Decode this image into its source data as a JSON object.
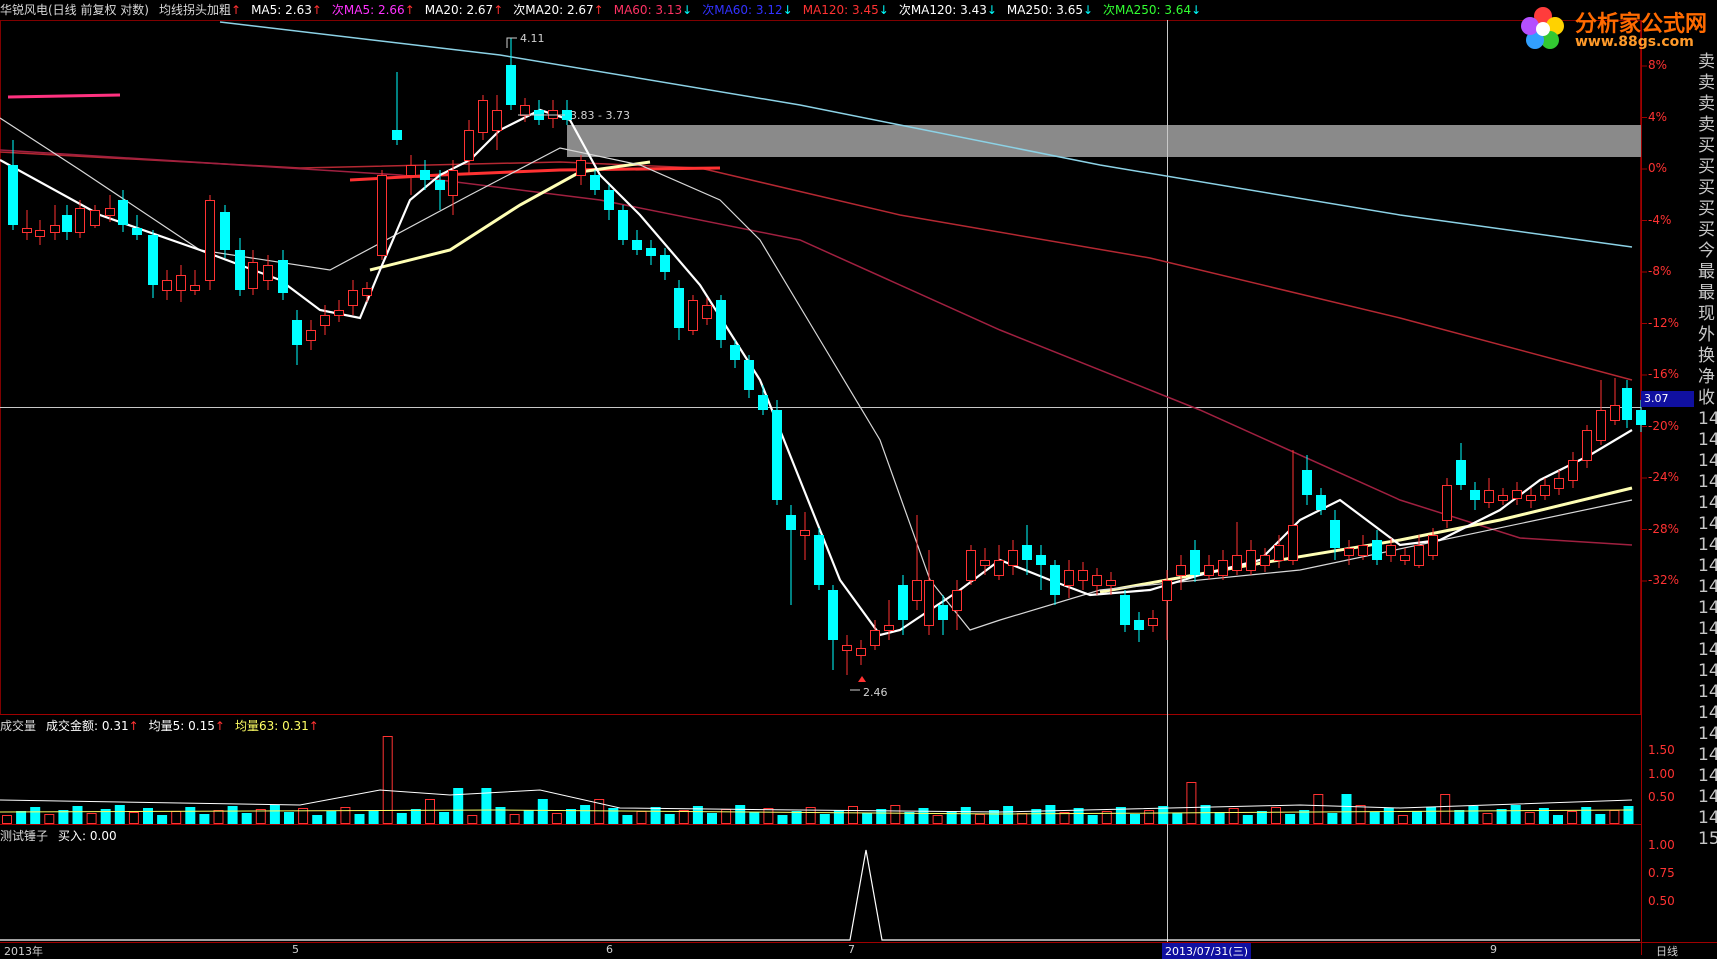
{
  "main_header": [
    {
      "label": "华锐风电(日线 前复权 对数)",
      "color": "#d8d8d8"
    },
    {
      "label": "均线拐头加粗",
      "color": "#d8d8d8",
      "arrow": "↑",
      "arrow_color": "#ff3232"
    },
    {
      "label": "MA5: 2.63",
      "color": "#ffffff",
      "arrow": "↑",
      "arrow_color": "#ff3232"
    },
    {
      "label": "次MA5: 2.66",
      "color": "#ff32ff",
      "arrow": "↑",
      "arrow_color": "#ff3232"
    },
    {
      "label": "MA20: 2.67",
      "color": "#ffffff",
      "arrow": "↑",
      "arrow_color": "#ff3232"
    },
    {
      "label": "次MA20: 2.67",
      "color": "#ffffff",
      "arrow": "↑",
      "arrow_color": "#ff3232"
    },
    {
      "label": "MA60: 3.13",
      "color": "#ff3264",
      "arrow": "↓",
      "arrow_color": "#00ffff"
    },
    {
      "label": "次MA60: 3.12",
      "color": "#3232ff",
      "arrow": "↓",
      "arrow_color": "#00ffff"
    },
    {
      "label": "MA120: 3.45",
      "color": "#ff3232",
      "arrow": "↓",
      "arrow_color": "#00ffff"
    },
    {
      "label": "次MA120: 3.43",
      "color": "#ffffff",
      "arrow": "↓",
      "arrow_color": "#00ffff"
    },
    {
      "label": "MA250: 3.65",
      "color": "#ffffff",
      "arrow": "↓",
      "arrow_color": "#00ffff"
    },
    {
      "label": "次MA250: 3.64",
      "color": "#32ff32",
      "arrow": "↓",
      "arrow_color": "#00ffff"
    }
  ],
  "volume_header": [
    {
      "label": "成交量",
      "color": "#d8d8d8"
    },
    {
      "label": "成交金额: 0.31",
      "color": "#ffffff",
      "arrow": "↑",
      "arrow_color": "#ff3232"
    },
    {
      "label": "均量5: 0.15",
      "color": "#ffffff",
      "arrow": "↑",
      "arrow_color": "#ff3232"
    },
    {
      "label": "均量63: 0.31",
      "color": "#ffff64",
      "arrow": "↑",
      "arrow_color": "#ff3232"
    }
  ],
  "indicator_header": [
    {
      "label": "测试锤子",
      "color": "#d8d8d8"
    },
    {
      "label": "买入: 0.00",
      "color": "#ffffff"
    }
  ],
  "right_axis_pct": [
    "8%",
    "4%",
    "0%",
    "-4%",
    "-8%",
    "-12%",
    "-16%",
    "-20%",
    "-24%",
    "-28%",
    "-32%"
  ],
  "right_axis_volume": [
    "1.50",
    "1.00",
    "0.50"
  ],
  "right_axis_indicator": [
    "1.00",
    "0.75",
    "0.50"
  ],
  "right_side_panel": [
    "卖",
    "卖",
    "卖",
    "卖",
    "买",
    "买",
    "买",
    "买",
    "买",
    "今",
    "最",
    "最",
    "现",
    "外",
    "换",
    "净",
    "收",
    "14",
    "14",
    "14",
    "14",
    "14",
    "14",
    "14",
    "14",
    "14",
    "14",
    "14",
    "14",
    "14",
    "14",
    "14",
    "14",
    "14",
    "14",
    "14",
    "14",
    "15"
  ],
  "price_annotations": {
    "high": "4.11",
    "range": "3.83 - 3.73",
    "low": "2.46",
    "current": "3.07"
  },
  "date_axis": [
    "2013年",
    "5",
    "6",
    "7",
    "9"
  ],
  "crosshair_date": "2013/07/31(三)",
  "period_label": "日线",
  "logo": {
    "title": "分析家公式网",
    "url": "www.88gs.com"
  }
}
